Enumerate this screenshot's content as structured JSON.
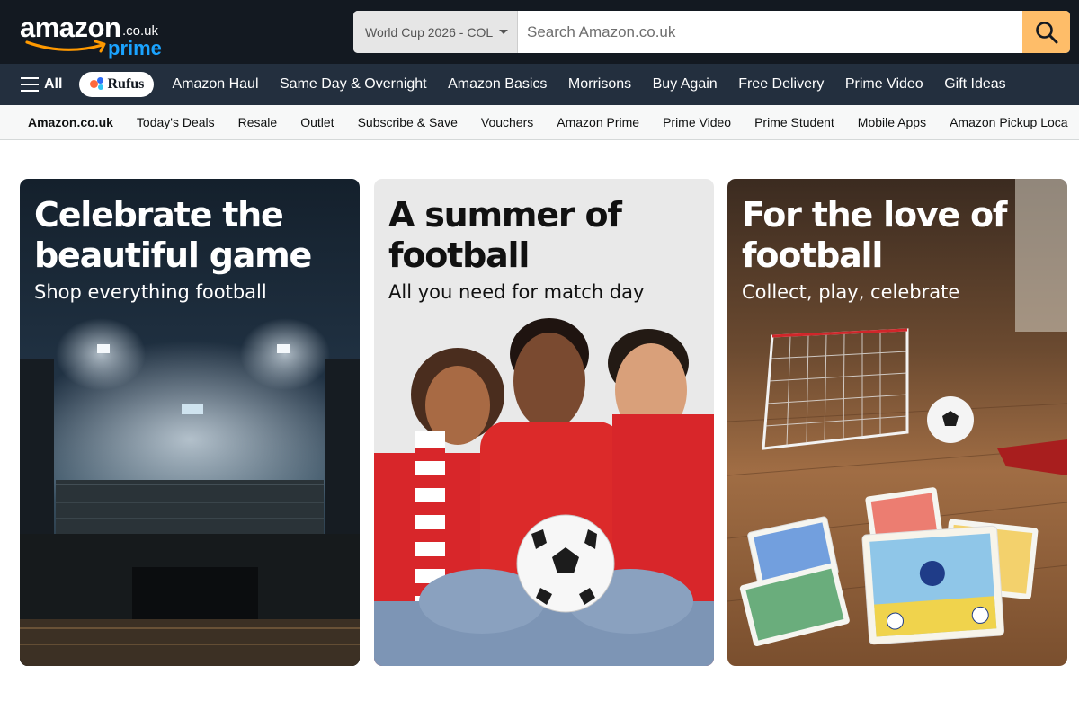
{
  "logo": {
    "word": "amazon",
    "tld": ".co.uk",
    "prime": "prime",
    "icon": "amazon-smile-logo"
  },
  "search": {
    "category": "World Cup 2026 - COL",
    "placeholder": "Search Amazon.co.uk",
    "value": "",
    "button_icon": "search-icon"
  },
  "nav": {
    "all_label": "All",
    "rufus_label": "Rufus",
    "items": [
      "Amazon Haul",
      "Same Day & Overnight",
      "Amazon Basics",
      "Morrisons",
      "Buy Again",
      "Free Delivery",
      "Prime Video",
      "Gift Ideas"
    ]
  },
  "subnav": {
    "items": [
      "Amazon.co.uk",
      "Today's Deals",
      "Resale",
      "Outlet",
      "Subscribe & Save",
      "Vouchers",
      "Amazon Prime",
      "Prime Video",
      "Prime Student",
      "Mobile Apps",
      "Amazon Pickup Loca"
    ]
  },
  "cards": [
    {
      "title": "Celebrate the beautiful game",
      "subtitle": "Shop everything football",
      "image": "football-stadium-at-night"
    },
    {
      "title": "A summer of football",
      "subtitle": "All you need for match day",
      "image": "three-fans-with-football"
    },
    {
      "title": "For the love of football",
      "subtitle": "Collect, play, celebrate",
      "image": "toy-goal-ball-and-trading-cards"
    }
  ],
  "colors": {
    "header": "#131921",
    "nav": "#232f3e",
    "search_button": "#febd69",
    "prime": "#1aa3ff"
  }
}
